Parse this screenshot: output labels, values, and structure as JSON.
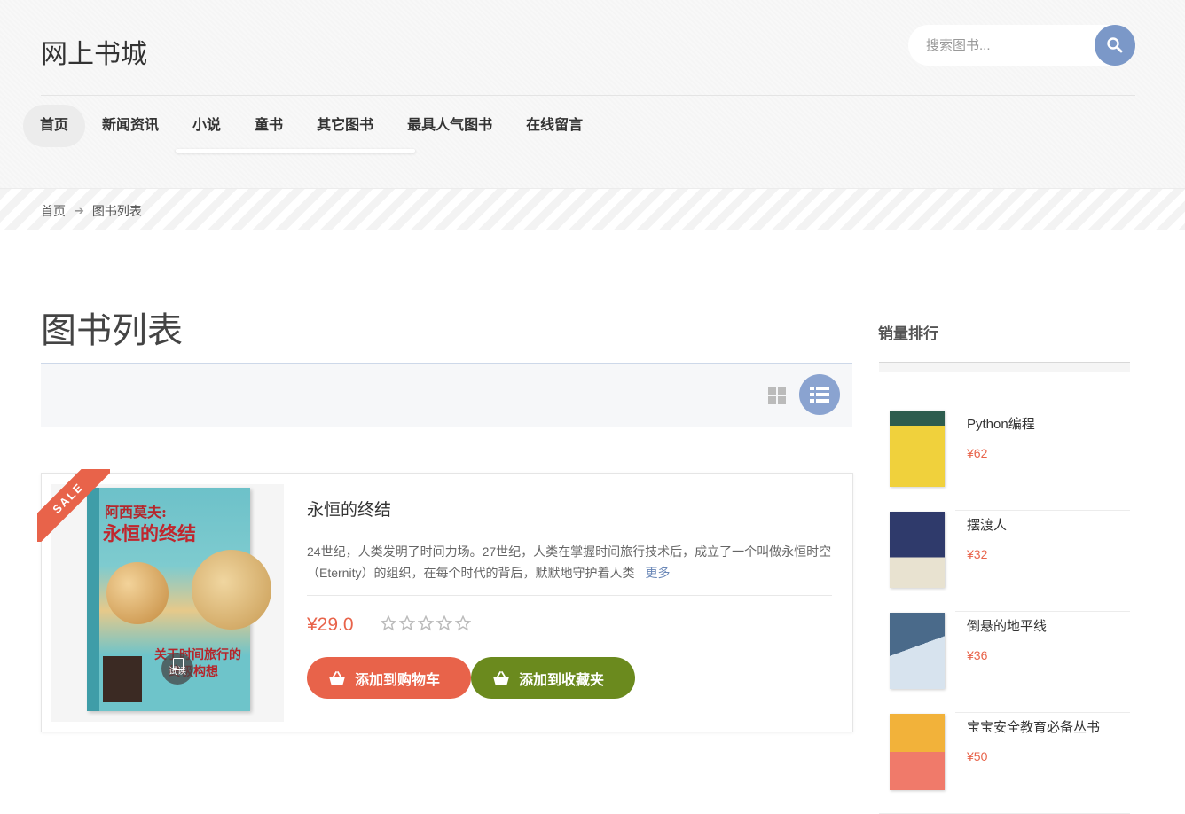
{
  "site": {
    "logo": "网上书城"
  },
  "search": {
    "placeholder": "搜索图书..."
  },
  "nav": {
    "items": [
      {
        "label": "首页"
      },
      {
        "label": "新闻资讯"
      },
      {
        "label": "小说"
      },
      {
        "label": "童书"
      },
      {
        "label": "其它图书"
      },
      {
        "label": "最具人气图书"
      },
      {
        "label": "在线留言"
      }
    ],
    "active": "首页"
  },
  "breadcrumb": {
    "home": "首页",
    "current": "图书列表"
  },
  "main": {
    "title": "图书列表"
  },
  "product": {
    "badge": "SALE",
    "title": "永恒的终结",
    "description": "24世纪，人类发明了时间力场。27世纪，人类在掌握时间旅行技术后，成立了一个叫做永恒时空（Eternity）的组织，在每个时代的背后，默默地守护着人类",
    "more": "更多",
    "price": "¥29.0",
    "rating": 0,
    "rating_max": 5,
    "try_read": "试读",
    "add_cart": "添加到购物车",
    "add_fav": "添加到收藏夹",
    "cover": {
      "author": "阿西莫夫:",
      "title": "永恒的终结",
      "line3": "关于时间旅行的",
      "line4": "终极构想"
    }
  },
  "sidebar": {
    "title": "销量排行",
    "items": [
      {
        "name": "Python编程",
        "price": "¥62",
        "cover_color": "#2d5c4e"
      },
      {
        "name": "摆渡人",
        "price": "¥32",
        "cover_color": "#2f3a6b"
      },
      {
        "name": "倒悬的地平线",
        "price": "¥36",
        "cover_color": "#4a6a8a"
      },
      {
        "name": "宝宝安全教育必备丛书",
        "price": "¥50",
        "cover_color": "#f2b23a"
      }
    ]
  },
  "colors": {
    "accent_red": "#e8634a",
    "accent_green": "#6b8a1e",
    "accent_blue": "#7b98c8"
  }
}
